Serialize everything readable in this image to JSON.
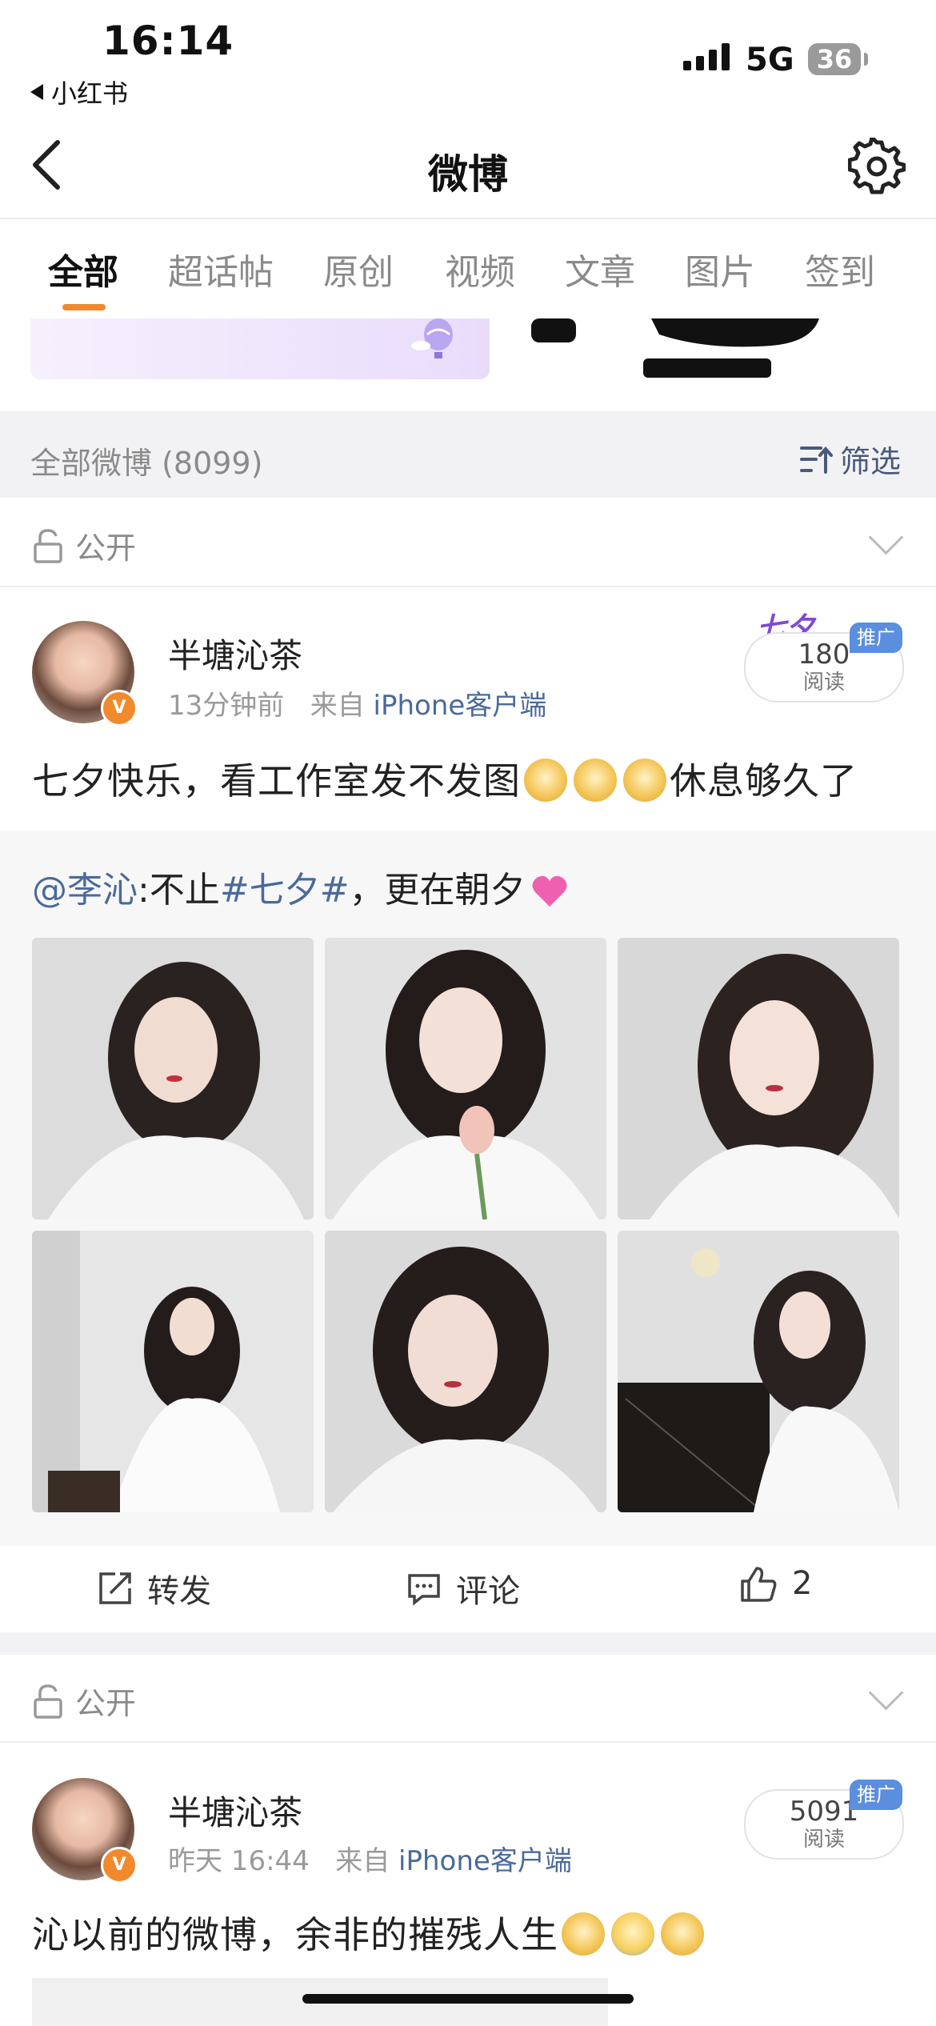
{
  "status_bar": {
    "time": "16:14",
    "back_app": "小红书",
    "network": "5G",
    "battery": "36"
  },
  "nav": {
    "title": "微博"
  },
  "tabs": [
    {
      "label": "全部",
      "active": true
    },
    {
      "label": "超话帖"
    },
    {
      "label": "原创"
    },
    {
      "label": "视频"
    },
    {
      "label": "文章"
    },
    {
      "label": "图片"
    },
    {
      "label": "签到"
    }
  ],
  "filter_bar": {
    "label": "全部微博 (8099)",
    "button": "筛选"
  },
  "posts": [
    {
      "visibility": "公开",
      "username": "半塘沁茶",
      "time": "13分钟前",
      "source_prefix": "来自",
      "source": "iPhone客户端",
      "reads": "180",
      "reads_label": "阅读",
      "promo_tag": "推广",
      "text_before": "七夕快乐，看工作室发不发图",
      "text_after": "休息够久了",
      "repost": {
        "mention": "@李沁",
        "sep": ":不止",
        "topic": "#七夕#",
        "rest": "，更在朝夕"
      },
      "actions": {
        "repost": "转发",
        "comment": "评论",
        "like": "2"
      }
    },
    {
      "visibility": "公开",
      "username": "半塘沁茶",
      "time": "昨天 16:44",
      "source_prefix": "来自",
      "source": "iPhone客户端",
      "reads": "5091",
      "reads_label": "阅读",
      "promo_tag": "推广",
      "text_before": "沁以前的微博，余非的摧残人生"
    }
  ],
  "colors": {
    "accent": "#f08a2c",
    "link": "#4a6a9a",
    "promo": "#5b8ede"
  },
  "icons": [
    "chevron-left-icon",
    "gear-icon",
    "filter-icon",
    "lock-open-icon",
    "chevron-down-icon",
    "repost-icon",
    "comment-icon",
    "thumbs-up-icon"
  ]
}
